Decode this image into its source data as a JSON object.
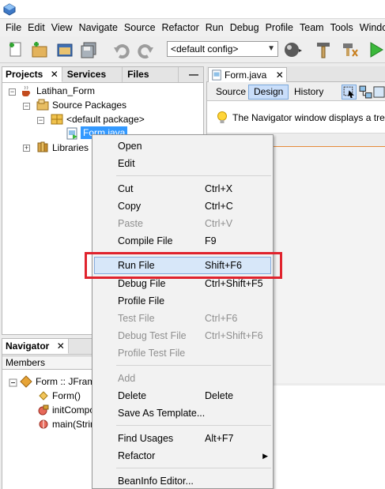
{
  "menubar": [
    "File",
    "Edit",
    "View",
    "Navigate",
    "Source",
    "Refactor",
    "Run",
    "Debug",
    "Profile",
    "Team",
    "Tools",
    "Window"
  ],
  "toolbar": {
    "config_value": "<default config>",
    "icons": [
      "new-file-icon",
      "new-project-icon",
      "open-project-icon",
      "save-all-icon",
      "undo-icon",
      "redo-icon",
      "clean-build-icon",
      "build-icon",
      "clean-icon",
      "run-icon"
    ]
  },
  "projects_panel": {
    "tabs": [
      {
        "label": "Projects",
        "close": "✕"
      },
      {
        "label": "Services"
      },
      {
        "label": "Files"
      }
    ],
    "minimize": "—",
    "tree": [
      {
        "label": "Latihan_Form"
      },
      {
        "label": "Source Packages"
      },
      {
        "label": "<default package>"
      },
      {
        "label": "Form.java"
      },
      {
        "label": "Libraries"
      }
    ]
  },
  "navigator_panel": {
    "tab": "Navigator",
    "close": "✕",
    "members": "Members",
    "tree": [
      {
        "label": "Form :: JFram"
      },
      {
        "label": "Form()"
      },
      {
        "label": "initCompon"
      },
      {
        "label": "main(Strin"
      }
    ]
  },
  "editor": {
    "tab": "Form.java",
    "tab_close": "✕",
    "buttons": [
      "Source",
      "Design",
      "History"
    ],
    "selected_button": "Design",
    "hint": "The Navigator window displays a tree hi"
  },
  "context_menu": {
    "items": [
      {
        "label": "Open",
        "shortcut": "",
        "enabled": true
      },
      {
        "label": "Edit",
        "shortcut": "",
        "enabled": true
      },
      {
        "label": "Cut",
        "shortcut": "Ctrl+X",
        "enabled": true
      },
      {
        "label": "Copy",
        "shortcut": "Ctrl+C",
        "enabled": true
      },
      {
        "label": "Paste",
        "shortcut": "Ctrl+V",
        "enabled": false
      },
      {
        "label": "Compile File",
        "shortcut": "F9",
        "enabled": true
      },
      {
        "label": "Run File",
        "shortcut": "Shift+F6",
        "enabled": true
      },
      {
        "label": "Debug File",
        "shortcut": "Ctrl+Shift+F5",
        "enabled": true
      },
      {
        "label": "Profile File",
        "shortcut": "",
        "enabled": true
      },
      {
        "label": "Test File",
        "shortcut": "Ctrl+F6",
        "enabled": false
      },
      {
        "label": "Debug Test File",
        "shortcut": "Ctrl+Shift+F6",
        "enabled": false
      },
      {
        "label": "Profile Test File",
        "shortcut": "",
        "enabled": false
      },
      {
        "label": "Add",
        "shortcut": "",
        "enabled": false
      },
      {
        "label": "Delete",
        "shortcut": "Delete",
        "enabled": true
      },
      {
        "label": "Save As Template...",
        "shortcut": "",
        "enabled": true
      },
      {
        "label": "Find Usages",
        "shortcut": "Alt+F7",
        "enabled": true
      },
      {
        "label": "Refactor",
        "shortcut": "",
        "enabled": true,
        "submenu": "▶"
      },
      {
        "label": "BeanInfo Editor...",
        "shortcut": "",
        "enabled": true
      }
    ],
    "highlighted": "Run File"
  },
  "colors": {
    "highlight_box": "#e0232d",
    "selection": "#3399ff",
    "menu_hover": "#d7e7f9"
  }
}
